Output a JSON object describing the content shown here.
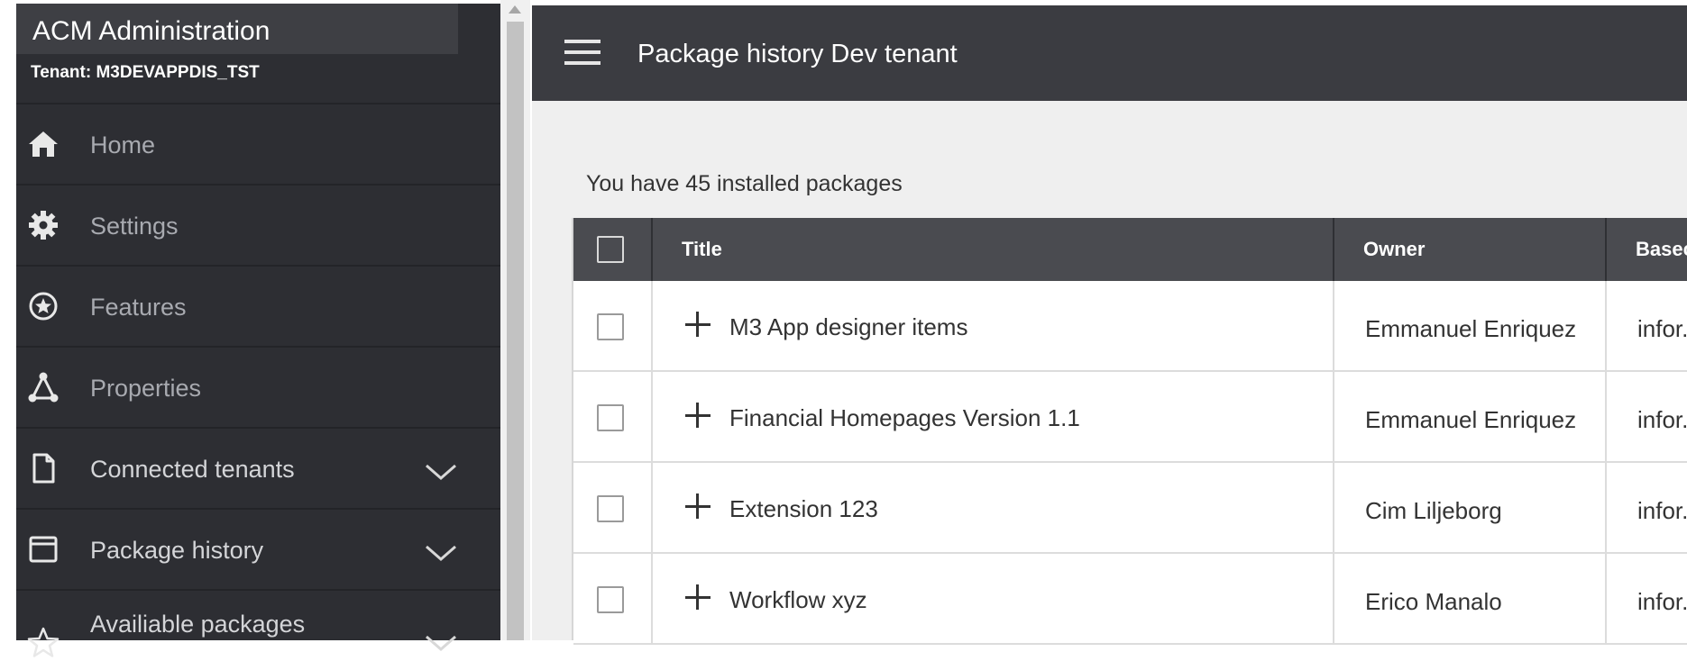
{
  "sidebar": {
    "app_title": "ACM Administration",
    "tenant": "Tenant: M3DEVAPPDIS_TST",
    "items": [
      {
        "label": "Home",
        "icon": "home-icon"
      },
      {
        "label": "Settings",
        "icon": "gear-icon"
      },
      {
        "label": "Features",
        "icon": "star-circle-icon"
      },
      {
        "label": "Properties",
        "icon": "network-icon"
      },
      {
        "label": "Connected tenants",
        "icon": "document-icon",
        "expandable": true
      },
      {
        "label": "Package history",
        "icon": "window-icon",
        "expandable": true
      },
      {
        "label": "Availiable packages",
        "icon": "star-icon",
        "expandable": true
      }
    ]
  },
  "header": {
    "title": "Package history Dev tenant"
  },
  "main": {
    "summary": "You have 45 installed packages",
    "table": {
      "columns": [
        "Title",
        "Owner",
        "Basec"
      ],
      "rows": [
        {
          "title": "M3 App designer items",
          "owner": "Emmanuel Enriquez",
          "based": "infor."
        },
        {
          "title": "Financial Homepages Version 1.1",
          "owner": "Emmanuel Enriquez",
          "based": "infor."
        },
        {
          "title": "Extension 123",
          "owner": "Cim Liljeborg",
          "based": "infor."
        },
        {
          "title": "Workflow xyz",
          "owner": "Erico Manalo",
          "based": "infor."
        }
      ]
    }
  },
  "colors": {
    "sidebar_bg": "#2d2e33",
    "topbar_bg": "#3b3c41",
    "table_header_bg": "#4a4b50",
    "content_bg": "#efefef"
  }
}
